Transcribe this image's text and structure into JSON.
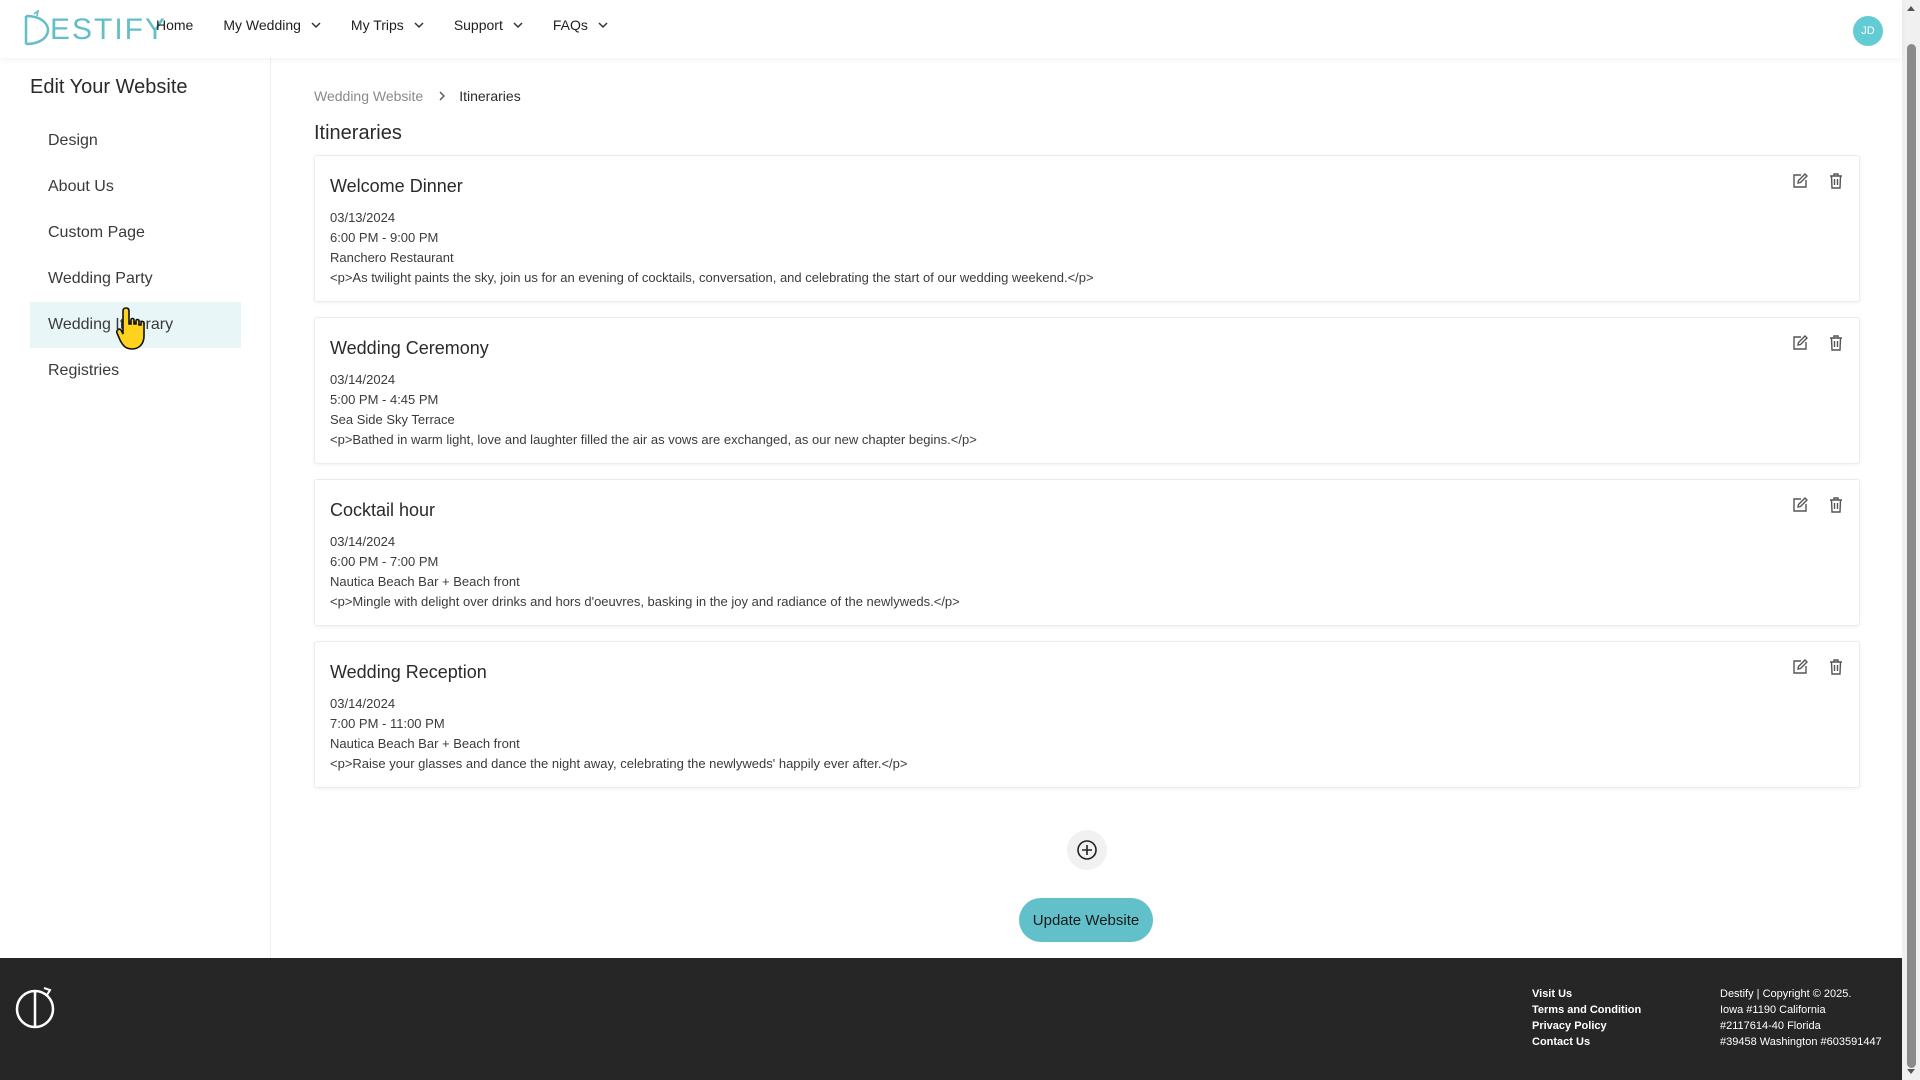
{
  "header": {
    "logo_text": "ESTIFY",
    "nav": [
      {
        "label": "Home",
        "has_dropdown": false
      },
      {
        "label": "My Wedding",
        "has_dropdown": true
      },
      {
        "label": "My Trips",
        "has_dropdown": true
      },
      {
        "label": "Support",
        "has_dropdown": true
      },
      {
        "label": "FAQs",
        "has_dropdown": true
      }
    ],
    "avatar_initials": "JD"
  },
  "sidebar": {
    "title": "Edit Your Website",
    "items": [
      {
        "label": "Design"
      },
      {
        "label": "About Us"
      },
      {
        "label": "Custom Page"
      },
      {
        "label": "Wedding Party"
      },
      {
        "label": "Wedding Itinerary",
        "active": true
      },
      {
        "label": "Registries"
      }
    ]
  },
  "main": {
    "breadcrumb": {
      "parent": "Wedding Website",
      "current": "Itineraries"
    },
    "title": "Itineraries",
    "events": [
      {
        "title": "Welcome Dinner",
        "date": "03/13/2024",
        "time": "6:00 PM - 9:00 PM",
        "location": "Ranchero Restaurant",
        "description": "<p>As twilight paints the sky, join us for an evening of cocktails, conversation, and celebrating the start of our wedding weekend.</p>"
      },
      {
        "title": "Wedding Ceremony",
        "date": "03/14/2024",
        "time": "5:00 PM - 4:45 PM",
        "location": "Sea Side Sky Terrace",
        "description": "<p>Bathed in warm light, love and laughter filled the air as vows are exchanged, as our new chapter begins.</p>"
      },
      {
        "title": "Cocktail hour",
        "date": "03/14/2024",
        "time": "6:00 PM - 7:00 PM",
        "location": "Nautica Beach Bar + Beach front",
        "description": "<p>Mingle with delight over drinks and hors d'oeuvres, basking in the joy and radiance of the newlyweds.</p>"
      },
      {
        "title": "Wedding Reception",
        "date": "03/14/2024",
        "time": "7:00 PM - 11:00 PM",
        "location": "Nautica Beach Bar + Beach front",
        "description": "<p>Raise your glasses and dance the night away, celebrating the newlyweds' happily ever after.</p>"
      }
    ],
    "update_label": "Update Website"
  },
  "footer": {
    "links": [
      "Visit Us",
      "Terms and Condition",
      "Privacy Policy",
      "Contact Us"
    ],
    "info": [
      "Destify | Copyright © 2025.",
      "Iowa #1190 California",
      "#2117614-40 Florida",
      "#39458 Washington #603591447"
    ]
  },
  "colors": {
    "accent": "#62c0ca",
    "active_bg": "#e9f6f8",
    "footer_bg": "#262626"
  }
}
